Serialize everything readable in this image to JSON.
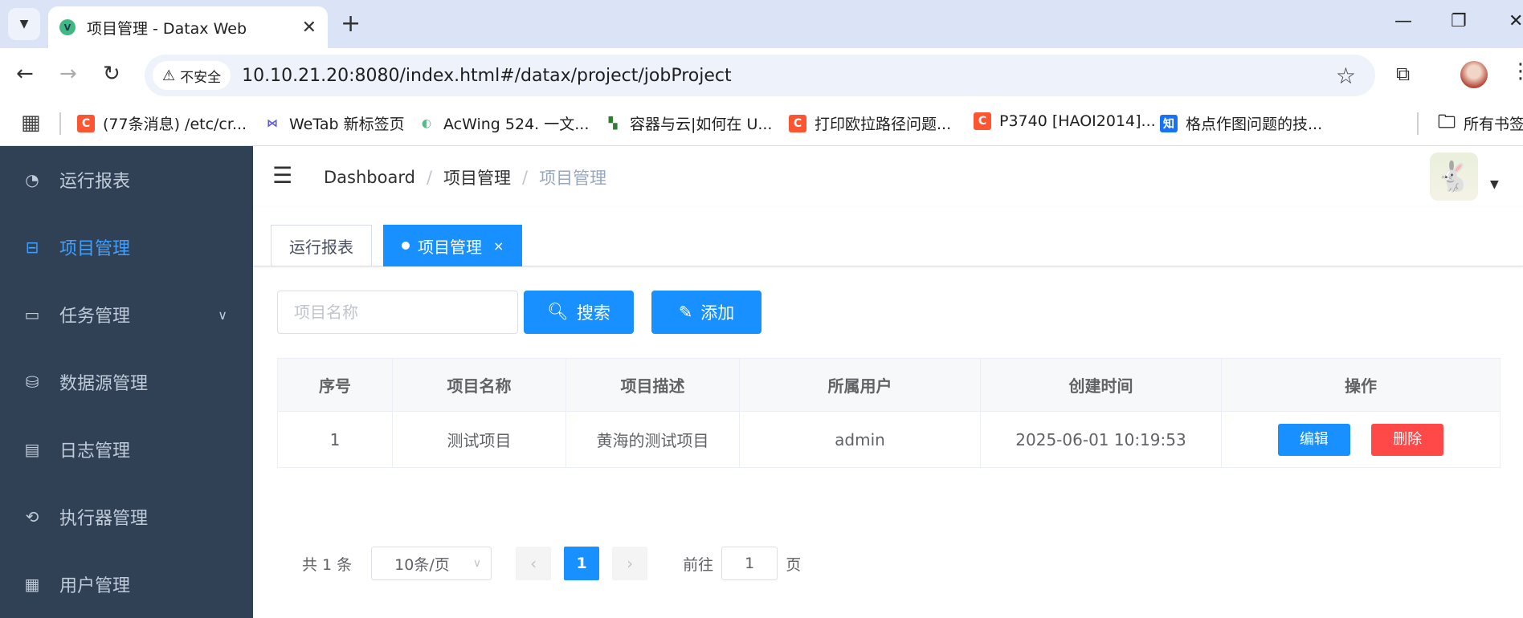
{
  "browser": {
    "tab_title": "项目管理 - Datax Web",
    "favicon_letter": "V",
    "new_tab": "+",
    "url_security": "不安全",
    "url": "10.10.21.20:8080/index.html#/datax/project/jobProject",
    "bookmarks": [
      {
        "label": "(77条消息) /etc/cr...",
        "icon": "C",
        "color": "#fc5531"
      },
      {
        "label": "WeTab 新标签页",
        "icon": "⋈",
        "color": "#5b5bd6"
      },
      {
        "label": "AcWing 524. 一文...",
        "icon": "◐",
        "color": "#55bb8a"
      },
      {
        "label": "容器与云|如何在 U...",
        "icon": "▚",
        "color": "#2e7d32"
      },
      {
        "label": "打印欧拉路径问题...",
        "icon": "C",
        "color": "#fc5531"
      },
      {
        "label": "P3740 [HAOI2014]...",
        "icon": "C",
        "color": "#fc5531"
      },
      {
        "label": "格点作图问题的技...",
        "icon": "知",
        "color": "#1772f6"
      },
      {
        "label": "所有书签",
        "icon": "🗀",
        "color": "#ffffff"
      }
    ]
  },
  "sidebar": {
    "items": [
      {
        "label": "运行报表",
        "icon": "dashboard-icon"
      },
      {
        "label": "项目管理",
        "icon": "project-icon"
      },
      {
        "label": "任务管理",
        "icon": "monitor-icon"
      },
      {
        "label": "数据源管理",
        "icon": "database-icon"
      },
      {
        "label": "日志管理",
        "icon": "log-icon"
      },
      {
        "label": "执行器管理",
        "icon": "executor-icon"
      },
      {
        "label": "用户管理",
        "icon": "user-table-icon"
      }
    ]
  },
  "breadcrumb": [
    "Dashboard",
    "项目管理",
    "项目管理"
  ],
  "tags": [
    {
      "label": "运行报表",
      "active": false
    },
    {
      "label": "项目管理",
      "active": true,
      "close": "×"
    }
  ],
  "filter": {
    "placeholder": "项目名称",
    "search_label": "搜索",
    "add_label": "添加"
  },
  "table": {
    "headers": [
      "序号",
      "项目名称",
      "项目描述",
      "所属用户",
      "创建时间",
      "操作"
    ],
    "rows": [
      {
        "index": "1",
        "name": "测试项目",
        "desc": "黄海的测试项目",
        "user": "admin",
        "created": "2025-06-01 10:19:53",
        "edit": "编辑",
        "delete": "删除"
      }
    ]
  },
  "pagination": {
    "total_text": "共 1 条",
    "page_size": "10条/页",
    "current_page": "1",
    "goto_prefix": "前往",
    "goto_value": "1",
    "goto_suffix": "页"
  },
  "colors": {
    "sidebar_bg": "#304156",
    "accent": "#1890ff",
    "danger": "#ff4949"
  }
}
